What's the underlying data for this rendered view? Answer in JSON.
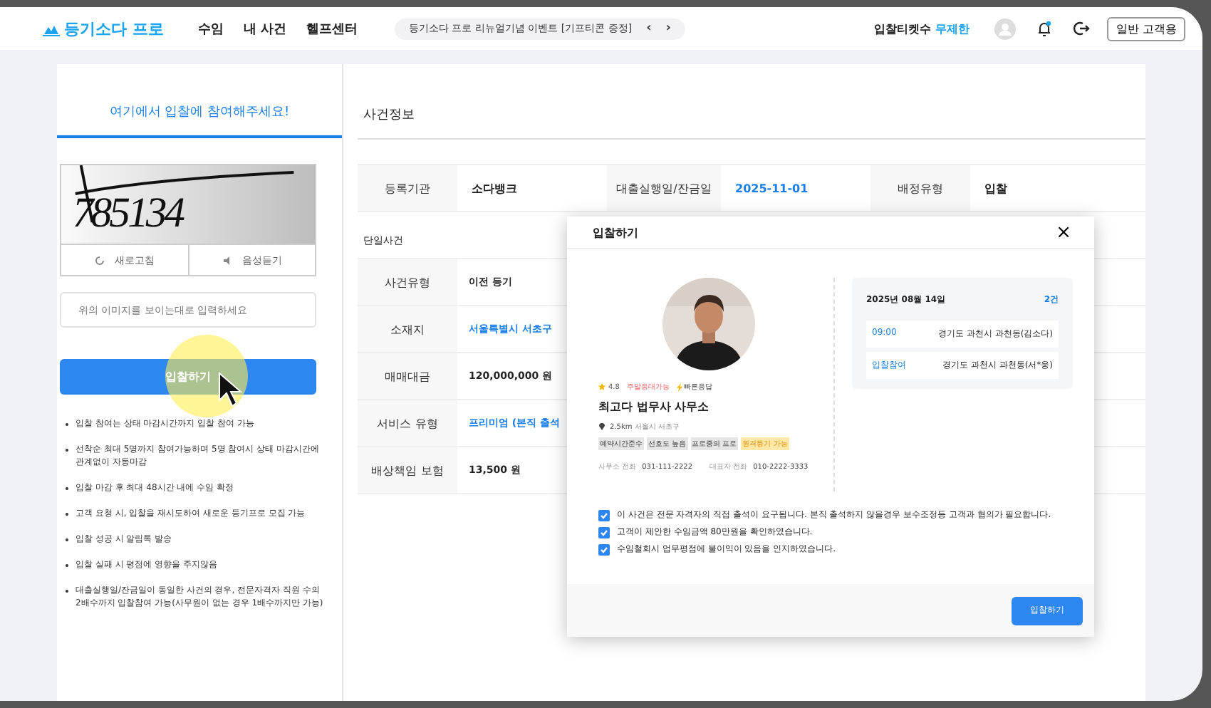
{
  "header": {
    "logo": "등기소다 프로",
    "nav": [
      "수임",
      "내 사건",
      "헬프센터"
    ],
    "notice": {
      "text": "등기소다 프로 리뉴얼기념 이벤트 [기프티콘 증정]",
      "prev": "‹",
      "next": "›"
    },
    "tickets": {
      "label": "입찰티켓수",
      "value": "무제한"
    },
    "mode_button": "일반 고객용"
  },
  "tabs": [
    {
      "label": "여기에서 입찰에 참여해주세요!",
      "selected": true
    },
    {
      "label": "사건정보",
      "selected": false
    }
  ],
  "captcha": {
    "code": "785134",
    "refresh": "새로고침",
    "audio": "음성듣기",
    "placeholder": "위의 이미지를 보이는대로 입력하세요",
    "submit": "입찰하기"
  },
  "notes": [
    "입찰 참여는 상태 마감시간까지 입찰 참여 가능",
    "선착순 최대 5명까지 참여가능하며 5명 참여시 상태 마감시간에 관계없이 자동마감",
    "입찰 마감 후 최대 48시간 내에 수임 확정",
    "고객 요청 시, 입찰을 재시도하여 새로운 등기프로 모집 가능",
    "입찰 성공 시 알림톡 발송",
    "입찰 실패 시 평점에 영향을 주지않음",
    "대출실행일/잔금일이 동일한 사건의 경우, 전문자격자 직원 수의 2배수까지 입찰참여 가능(사무원이 없는 경우 1배수까지만 가능)"
  ],
  "info": {
    "top_row": [
      {
        "label": "등록기관",
        "value": "소다뱅크",
        "kind": "plain"
      },
      {
        "label": "대출실행일/잔금일",
        "value": "2025-11-01",
        "kind": "link"
      },
      {
        "label": "배정유형",
        "value": "입찰",
        "kind": "plain"
      }
    ],
    "section": "단일사건",
    "rows": [
      {
        "label": "사건유형",
        "value": "이전 등기",
        "kind": "plain"
      },
      {
        "label": "소재지",
        "value": "서울특별시 서초구",
        "kind": "link"
      },
      {
        "label": "매매대금",
        "value": "120,000,000 원",
        "kind": "plain"
      },
      {
        "label": "서비스 유형",
        "value": "프리미엄 (본직 출석",
        "kind": "link"
      },
      {
        "label": "배상책임 보험",
        "value": "13,500 원",
        "kind": "plain"
      }
    ]
  },
  "modal": {
    "title": "입찰하기",
    "close": "×",
    "profile": {
      "kind": "picture",
      "badges": [
        {
          "text": "4.8",
          "kind": "rating"
        },
        {
          "text": "주말응대가능",
          "kind": "alert"
        },
        {
          "text": "빠른응답",
          "kind": "fast"
        }
      ],
      "name": "최고다 법무사 사무소",
      "distance": "2.5km",
      "area": "서울시 서초구",
      "tags": [
        {
          "text": "예약시간준수",
          "kind": "plain"
        },
        {
          "text": "선호도 높음",
          "kind": "plain"
        },
        {
          "text": "프로중의 프로",
          "kind": "plain"
        },
        {
          "text": "원격등기 가능",
          "kind": "highlight"
        }
      ],
      "phones": [
        {
          "label": "사무소 전화",
          "number": "031-111-2222"
        },
        {
          "label": "대표자 전화",
          "number": "010-2222-3333"
        }
      ]
    },
    "schedule": {
      "date": "2025년 08월 14일",
      "count": "2건",
      "items": [
        {
          "time": "09:00",
          "address": "경기도 과천시 과천동(김소다)"
        },
        {
          "time": "입찰참여",
          "address": "경기도 과천시 과천동(서*웅)"
        }
      ]
    },
    "agreements": [
      {
        "text": "이 사건은 전문 자격자의 직접 출석이 요구됩니다. 본직 출석하지 않을경우 보수조정등 고객과 협의가 필요합니다.",
        "checked": true
      },
      {
        "text": "고객이 제안한 수임금액 80만원을 확인하였습니다.",
        "checked": true
      },
      {
        "text": "수임철회시 업무평점에 불이익이 있음을 인지하였습니다.",
        "checked": true
      }
    ],
    "submit": "입찰하기"
  }
}
